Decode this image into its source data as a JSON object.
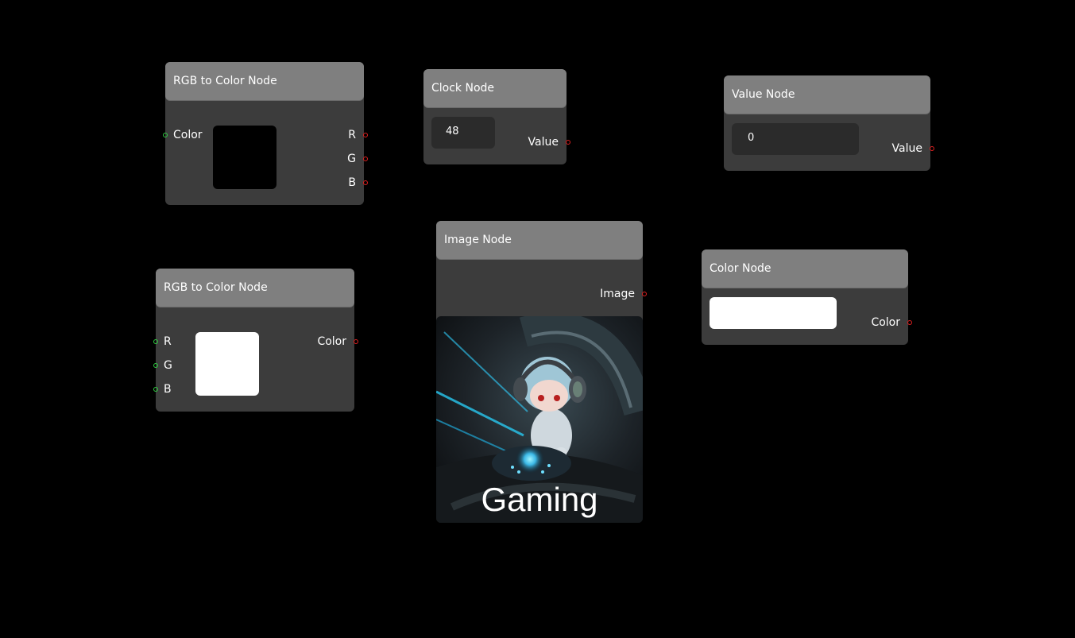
{
  "nodes": {
    "rgb_to_color_1": {
      "title": "RGB to Color Node",
      "input_color_label": "Color",
      "output_r_label": "R",
      "output_g_label": "G",
      "output_b_label": "B",
      "swatch_color": "#000000"
    },
    "rgb_to_color_2": {
      "title": "RGB to Color Node",
      "input_r_label": "R",
      "input_g_label": "G",
      "input_b_label": "B",
      "output_color_label": "Color",
      "swatch_color": "#ffffff"
    },
    "clock": {
      "title": "Clock Node",
      "value": "48",
      "output_label": "Value"
    },
    "value": {
      "title": "Value Node",
      "value": "0",
      "output_label": "Value"
    },
    "image": {
      "title": "Image Node",
      "output_label": "Image",
      "image_caption": "Gaming"
    },
    "color": {
      "title": "Color Node",
      "output_label": "Color",
      "swatch_color": "#ffffff"
    }
  },
  "colors": {
    "canvas_bg": "#000000",
    "node_body": "#3c3c3c",
    "node_header": "#7f7f7f",
    "input_port": "#2ecc40",
    "output_port": "#e02020"
  }
}
